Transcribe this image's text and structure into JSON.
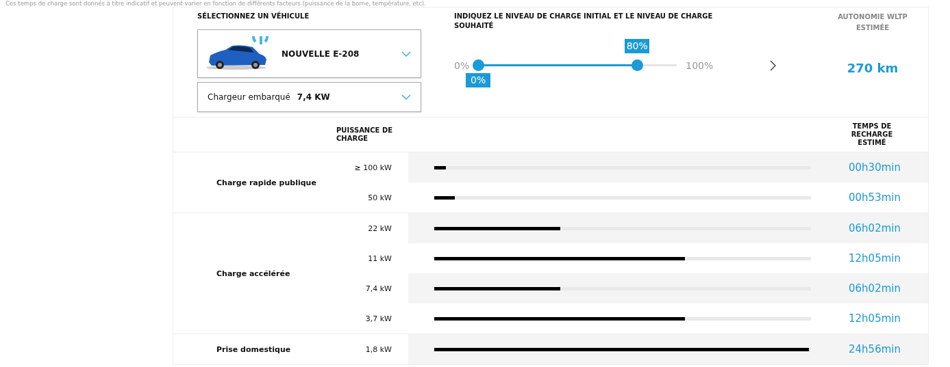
{
  "note": "Ces temps de charge sont donnés à titre indicatif et peuvent varier en fonction de différents facteurs (puissance de la borne, température, etc).",
  "vehicle": {
    "heading": "SÉLECTIONNEZ UN VÉHICULE",
    "model": "NOUVELLE E-208",
    "charger_label": "Chargeur embarqué",
    "charger_value": "7,4 KW"
  },
  "charge_level": {
    "heading": "INDIQUEZ LE NIVEAU DE CHARGE INITIAL ET LE NIVEAU DE CHARGE SOUHAITÉ",
    "min_label": "0%",
    "max_label": "100%",
    "start": {
      "label": "0%",
      "level": 0
    },
    "end": {
      "label": "80%",
      "level": 0.8
    }
  },
  "range": {
    "heading": "AUTONOMIE WLTP ESTIMÉE",
    "value": "270 km"
  },
  "table": {
    "columns": [
      "PUISSANCE DE CHARGE",
      "TEMPS DE RECHARGE ESTIMÉ"
    ],
    "groups": [
      {
        "name": "Charge rapide publique",
        "rows": [
          {
            "power": "≥ 100 kW",
            "level": 0.03,
            "time": "00h30min"
          },
          {
            "power": "50 kW",
            "level": 0.055,
            "time": "00h53min"
          }
        ]
      },
      {
        "name": "Charge accélérée",
        "rows": [
          {
            "power": "22 kW",
            "level": 0.335,
            "time": "06h02min"
          },
          {
            "power": "11 kW",
            "level": 0.665,
            "time": "12h05min"
          },
          {
            "power": "7,4 kW",
            "level": 0.335,
            "time": "06h02min"
          },
          {
            "power": "3,7 kW",
            "level": 0.665,
            "time": "12h05min"
          }
        ]
      },
      {
        "name": "Prise domestique",
        "rows": [
          {
            "power": "1,8 kW",
            "level": 0.995,
            "time": "24h56min"
          }
        ]
      }
    ]
  }
}
